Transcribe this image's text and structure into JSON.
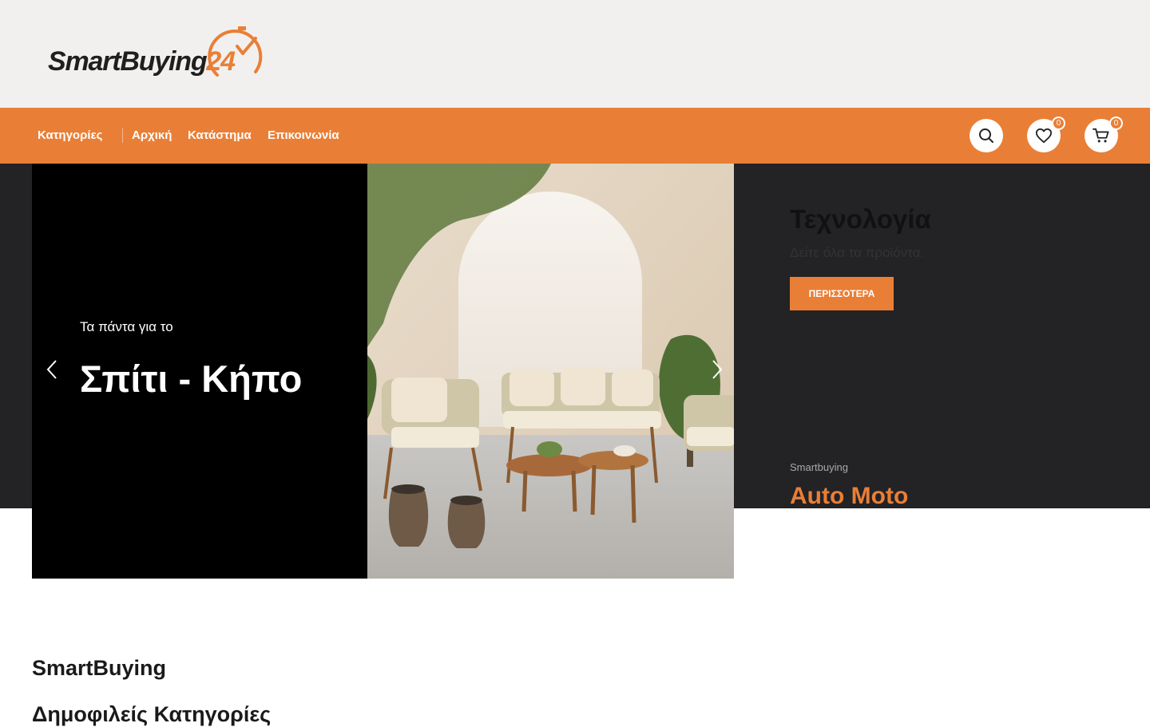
{
  "brand": {
    "logo_main": "SmartBuying",
    "logo_number": "24",
    "accent_color": "#e97f36",
    "dark_color": "#232225"
  },
  "nav": {
    "items": [
      {
        "label": "Κατηγορίες"
      },
      {
        "label": "Αρχική"
      },
      {
        "label": "Κατάστημα"
      },
      {
        "label": "Επικοινωνία"
      }
    ],
    "search_icon": "search-icon",
    "wishlist_icon": "heart-icon",
    "wishlist_count": "0",
    "cart_icon": "cart-icon",
    "cart_count": "0"
  },
  "slider": {
    "subtitle": "Τα πάντα για το",
    "title": "Σπίτι - Κήπο",
    "prev_icon": "chevron-left-icon",
    "next_icon": "chevron-right-icon"
  },
  "promo": {
    "title": "Τεχνολογία",
    "subtitle": "Δείτε όλα τα προϊόντα.",
    "button_label": "ΠΕΡΙΣΣΟΤΕΡΑ"
  },
  "promo2": {
    "small": "Smartbuying",
    "title": "Auto Moto"
  },
  "section": {
    "title": "SmartBuying",
    "subtitle": "Δημοφιλείς Κατηγορίες"
  }
}
